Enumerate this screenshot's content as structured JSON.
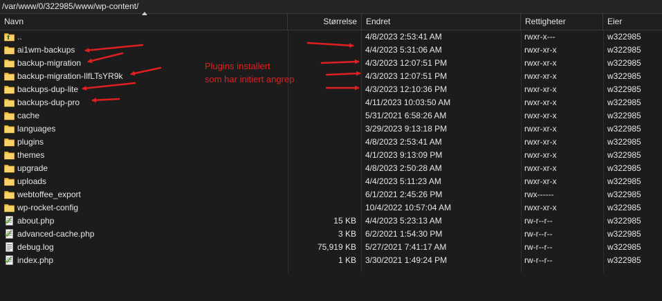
{
  "path": "/var/www/0/322985/www/wp-content/",
  "columns": {
    "name": "Navn",
    "size": "Størrelse",
    "modified": "Endret",
    "permissions": "Rettigheter",
    "owner": "Eier"
  },
  "files": [
    {
      "name": "..",
      "size": "",
      "modified": "4/8/2023 2:53:41 AM",
      "perm": "rwxr-x---",
      "owner": "w322985",
      "icon": "folder-up-icon"
    },
    {
      "name": "ai1wm-backups",
      "size": "",
      "modified": "4/4/2023 5:31:06 AM",
      "perm": "rwxr-xr-x",
      "owner": "w322985",
      "icon": "folder-icon"
    },
    {
      "name": "backup-migration",
      "size": "",
      "modified": "4/3/2023 12:07:51 PM",
      "perm": "rwxr-xr-x",
      "owner": "w322985",
      "icon": "folder-icon"
    },
    {
      "name": "backup-migration-IlfLTsYR9k",
      "size": "",
      "modified": "4/3/2023 12:07:51 PM",
      "perm": "rwxr-xr-x",
      "owner": "w322985",
      "icon": "folder-icon"
    },
    {
      "name": "backups-dup-lite",
      "size": "",
      "modified": "4/3/2023 12:10:36 PM",
      "perm": "rwxr-xr-x",
      "owner": "w322985",
      "icon": "folder-icon"
    },
    {
      "name": "backups-dup-pro",
      "size": "",
      "modified": "4/11/2023 10:03:50 AM",
      "perm": "rwxr-xr-x",
      "owner": "w322985",
      "icon": "folder-icon"
    },
    {
      "name": "cache",
      "size": "",
      "modified": "5/31/2021 6:58:26 AM",
      "perm": "rwxr-xr-x",
      "owner": "w322985",
      "icon": "folder-icon"
    },
    {
      "name": "languages",
      "size": "",
      "modified": "3/29/2023 9:13:18 PM",
      "perm": "rwxr-xr-x",
      "owner": "w322985",
      "icon": "folder-icon"
    },
    {
      "name": "plugins",
      "size": "",
      "modified": "4/8/2023 2:53:41 AM",
      "perm": "rwxr-xr-x",
      "owner": "w322985",
      "icon": "folder-icon"
    },
    {
      "name": "themes",
      "size": "",
      "modified": "4/1/2023 9:13:09 PM",
      "perm": "rwxr-xr-x",
      "owner": "w322985",
      "icon": "folder-icon"
    },
    {
      "name": "upgrade",
      "size": "",
      "modified": "4/8/2023 2:50:28 AM",
      "perm": "rwxr-xr-x",
      "owner": "w322985",
      "icon": "folder-icon"
    },
    {
      "name": "uploads",
      "size": "",
      "modified": "4/4/2023 5:11:23 AM",
      "perm": "rwxr-xr-x",
      "owner": "w322985",
      "icon": "folder-icon"
    },
    {
      "name": "webtoffee_export",
      "size": "",
      "modified": "6/1/2021 2:45:26 PM",
      "perm": "rwx------",
      "owner": "w322985",
      "icon": "folder-icon"
    },
    {
      "name": "wp-rocket-config",
      "size": "",
      "modified": "10/4/2022 10:57:04 AM",
      "perm": "rwxr-xr-x",
      "owner": "w322985",
      "icon": "folder-icon"
    },
    {
      "name": "about.php",
      "size": "15 KB",
      "modified": "4/4/2023 5:23:13 AM",
      "perm": "rw-r--r--",
      "owner": "w322985",
      "icon": "php-file-icon"
    },
    {
      "name": "advanced-cache.php",
      "size": "3 KB",
      "modified": "6/2/2021 1:54:30 PM",
      "perm": "rw-r--r--",
      "owner": "w322985",
      "icon": "php-file-icon"
    },
    {
      "name": "debug.log",
      "size": "75,919 KB",
      "modified": "5/27/2021 7:41:17 AM",
      "perm": "rw-r--r--",
      "owner": "w322985",
      "icon": "text-file-icon"
    },
    {
      "name": "index.php",
      "size": "1 KB",
      "modified": "3/30/2021 1:49:24 PM",
      "perm": "rw-r--r--",
      "owner": "w322985",
      "icon": "php-file-icon"
    }
  ],
  "annotation": {
    "line1": "Plugins installert",
    "line2": "som har initiert angrep",
    "color": "#e02020"
  },
  "colors": {
    "background": "#1c1c1c",
    "folder": "#f2c24b",
    "text": "#e6e6e6"
  }
}
